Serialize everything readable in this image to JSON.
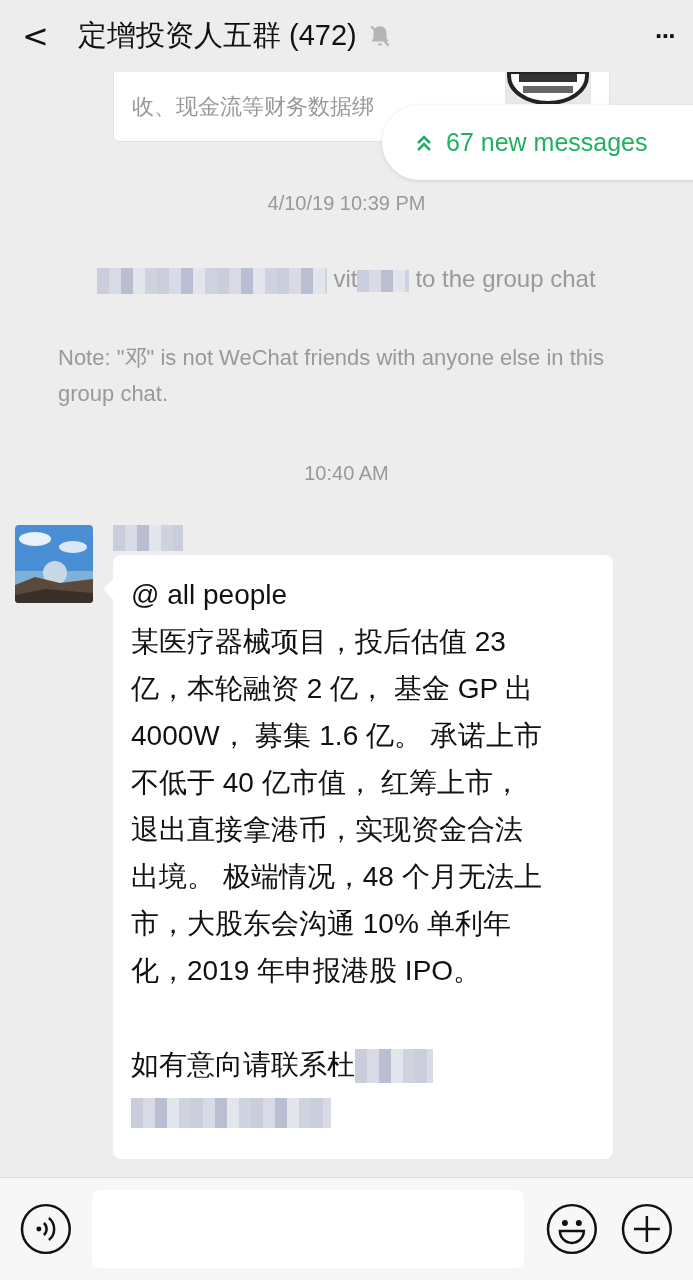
{
  "header": {
    "back": "<",
    "title": "定增投资人五群 (472)",
    "muted": true,
    "more": "···"
  },
  "shared_card": {
    "lines": [
      "收、现金流等财务数据绑"
    ],
    "thumbnail": {
      "kind": "picture"
    }
  },
  "new_messages": {
    "label": "67 new messages"
  },
  "items": [
    {
      "kind": "time",
      "text": "4/10/19 10:39 PM"
    },
    {
      "kind": "system",
      "parts": [
        "vit",
        "to the group chat"
      ]
    },
    {
      "kind": "note",
      "text": "Note: \"邓\" is not WeChat friends with anyone else in this group chat."
    },
    {
      "kind": "time",
      "text": "10:40 AM"
    },
    {
      "kind": "message",
      "lines": [
        "@ all people",
        "某医疗器械项目，投后估值 23",
        "亿，本轮融资 2 亿， 基金 GP 出",
        "4000W， 募集 1.6 亿。 承诺上市",
        "不低于 40 亿市值， 红筹上市，",
        "退出直接拿港币，实现资金合法",
        "出境。 极端情况，48 个月无法上",
        "市，大股东会沟通 10% 单利年",
        "化，2019 年申报港股 IPO。"
      ],
      "contact": "如有意向请联系杜"
    }
  ]
}
